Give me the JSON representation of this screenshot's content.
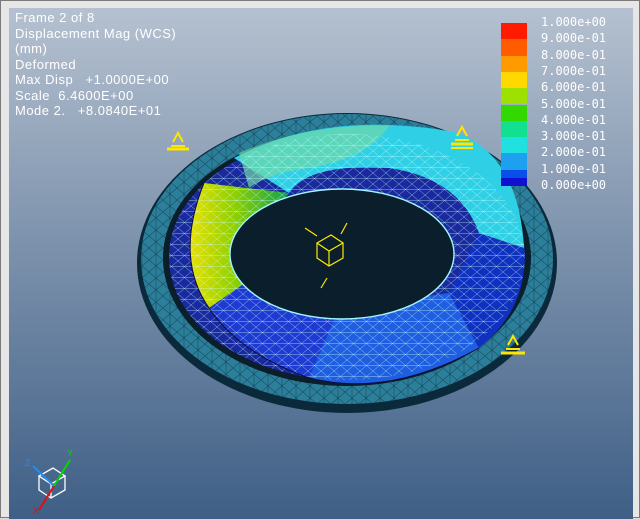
{
  "info": {
    "frame": "Frame 2 of 8",
    "result": "Displacement Mag (WCS)",
    "units": "(mm)",
    "state": "Deformed",
    "max_disp": "Max Disp   +1.0000E+00",
    "scale": "Scale  6.4600E+00",
    "mode": "Mode 2.   +8.0840E+01"
  },
  "legend": {
    "labels": [
      "1.000e+00",
      "9.000e-01",
      "8.000e-01",
      "7.000e-01",
      "6.000e-01",
      "5.000e-01",
      "4.000e-01",
      "3.000e-01",
      "2.000e-01",
      "1.000e-01",
      "0.000e+00"
    ],
    "colors": [
      "#ff1a00",
      "#ff5c00",
      "#ff9a00",
      "#ffd800",
      "#9ee000",
      "#32d800",
      "#10e090",
      "#20e0e0",
      "#1ea0f0",
      "#0a50e8",
      "#1010d0"
    ]
  },
  "triad": {
    "x_label": "X",
    "y_label": "Y",
    "z_label": "Z"
  }
}
